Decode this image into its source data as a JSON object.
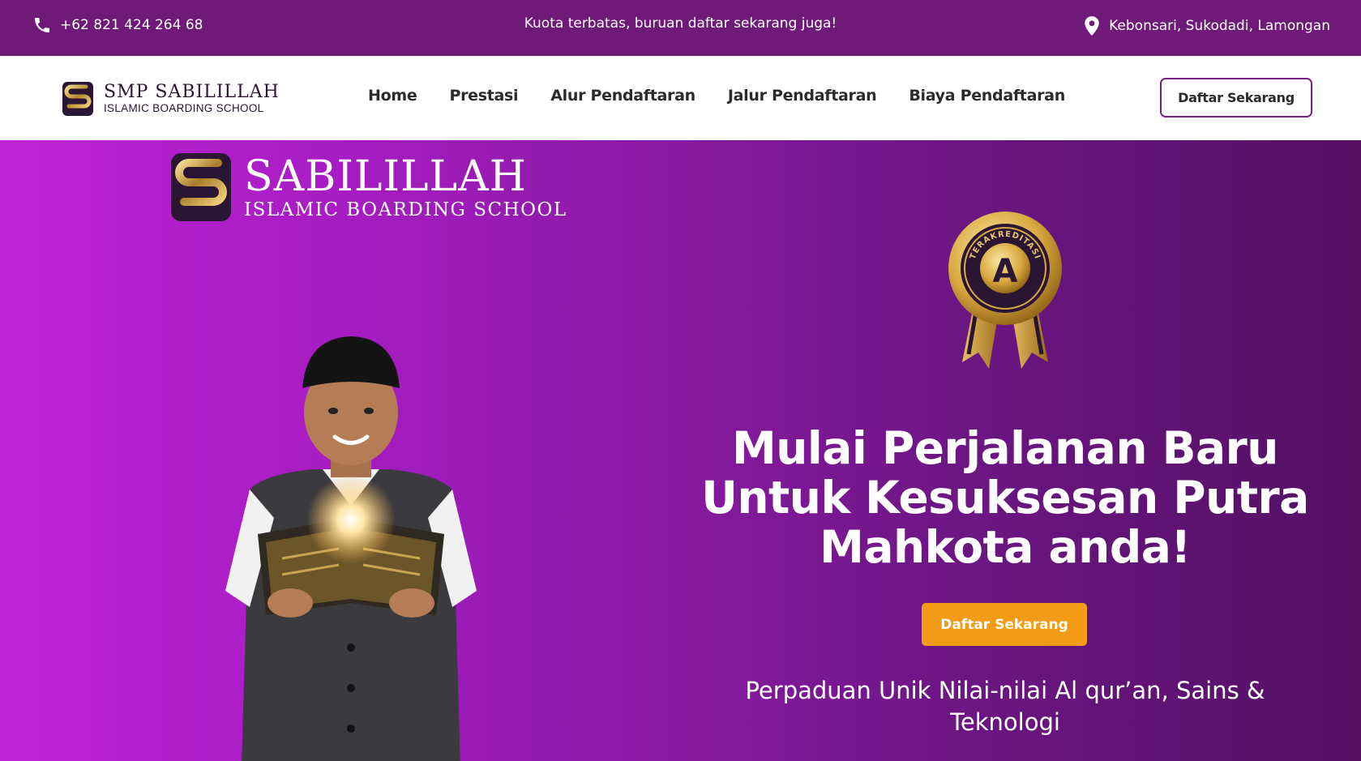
{
  "topbar": {
    "phone": "+62 821 424 264 68",
    "message": "Kuota terbatas, buruan daftar sekarang juga!",
    "location": "Kebonsari, Sukodadi, Lamongan",
    "icons": {
      "phone": "phone-icon",
      "location": "map-pin-icon"
    }
  },
  "header": {
    "logo_title": "SMP SABILILLAH",
    "logo_subtitle": "ISLAMIC BOARDING SCHOOL",
    "nav": [
      "Home",
      "Prestasi",
      "Alur Pendaftaran",
      "Jalur Pendaftaran",
      "Biaya Pendaftaran"
    ],
    "cta": "Daftar Sekarang"
  },
  "hero": {
    "logo_title": "SABILILLAH",
    "logo_subtitle": "ISLAMIC BOARDING SCHOOL",
    "badge_text": "TERAKREDITASI",
    "badge_grade": "A",
    "headline": "Mulai Perjalanan Baru Untuk Kesuksesan Putra Mahkota anda!",
    "cta": "Daftar Sekarang",
    "subline": "Perpaduan Unik Nilai-nilai Al qur’an, Sains & Teknologi"
  },
  "colors": {
    "topbar_bg": "#6f1a78",
    "accent": "#7a1d86",
    "cta_orange": "#f29b16",
    "hero_gradient_start": "#be24d3",
    "hero_gradient_end": "#531063"
  }
}
